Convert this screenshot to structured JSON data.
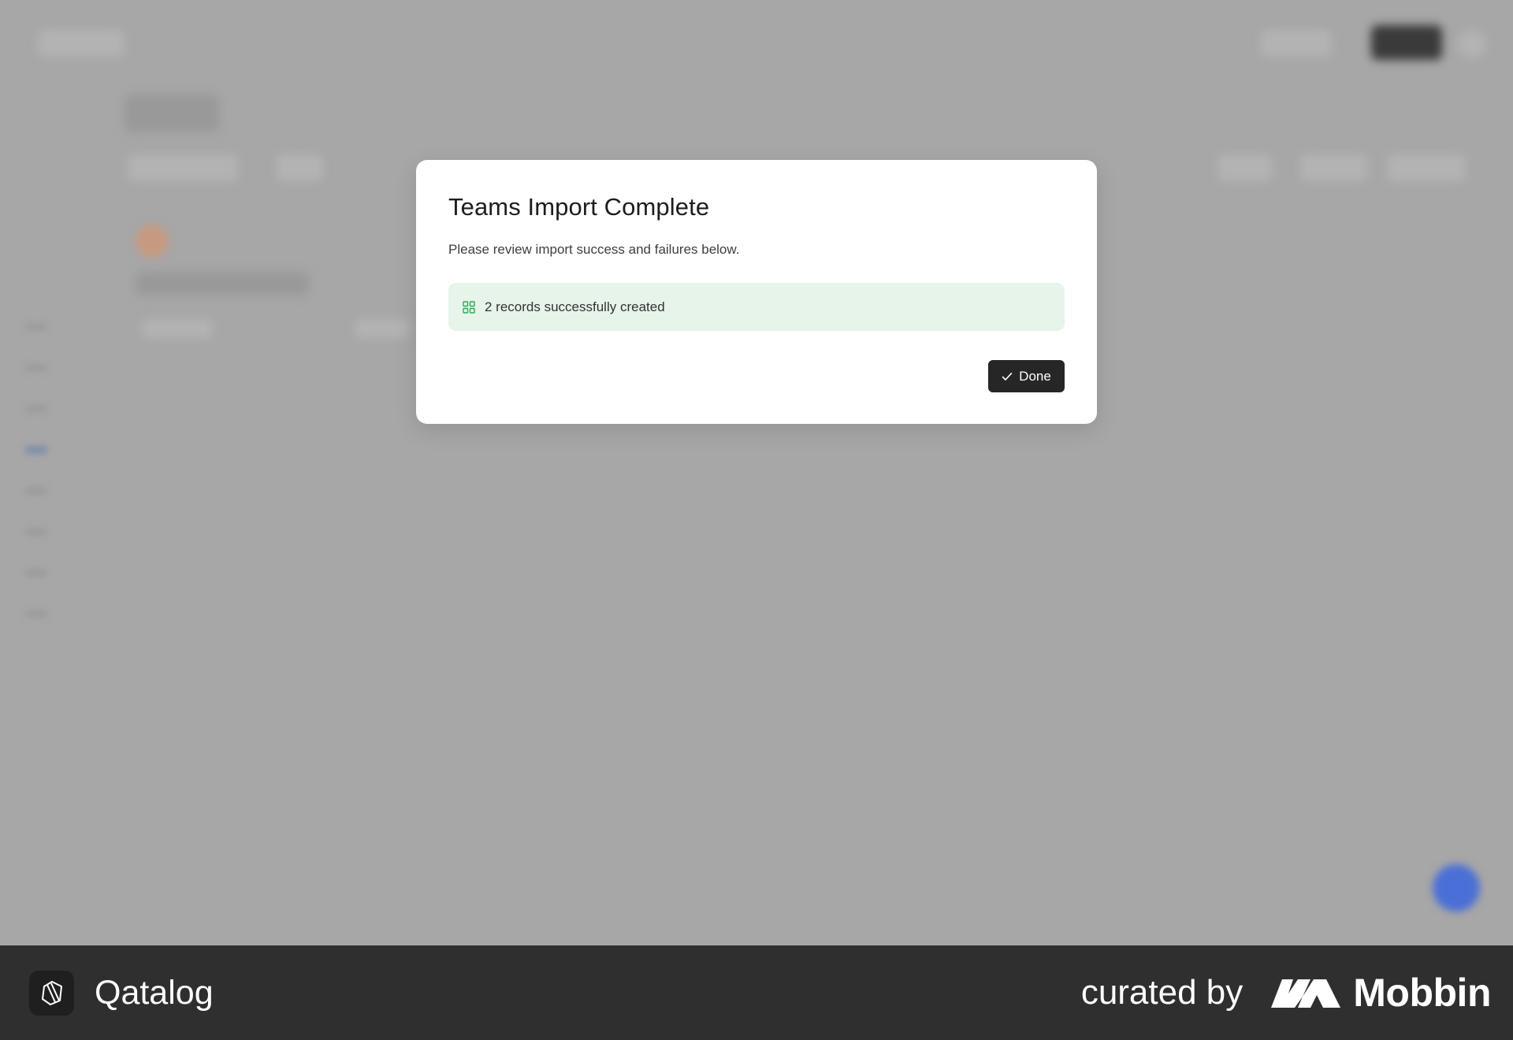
{
  "modal": {
    "title": "Teams Import Complete",
    "subtitle": "Please review import success and failures below.",
    "success_message": "2 records successfully created",
    "done_label": "Done"
  },
  "footer": {
    "app_name": "Qatalog",
    "curated_label": "curated by",
    "brand": "Mobbin"
  },
  "colors": {
    "overlay": "#a7a7a7",
    "success_bg": "#e6f4ea",
    "success_icon": "#34a853",
    "button_bg": "#262626",
    "footer_bg": "#2f2f2f"
  },
  "icons": {
    "success": "grid-icon",
    "done": "check-icon",
    "app_logo": "qatalog-logo-icon",
    "brand_logo": "mobbin-logo-icon"
  }
}
